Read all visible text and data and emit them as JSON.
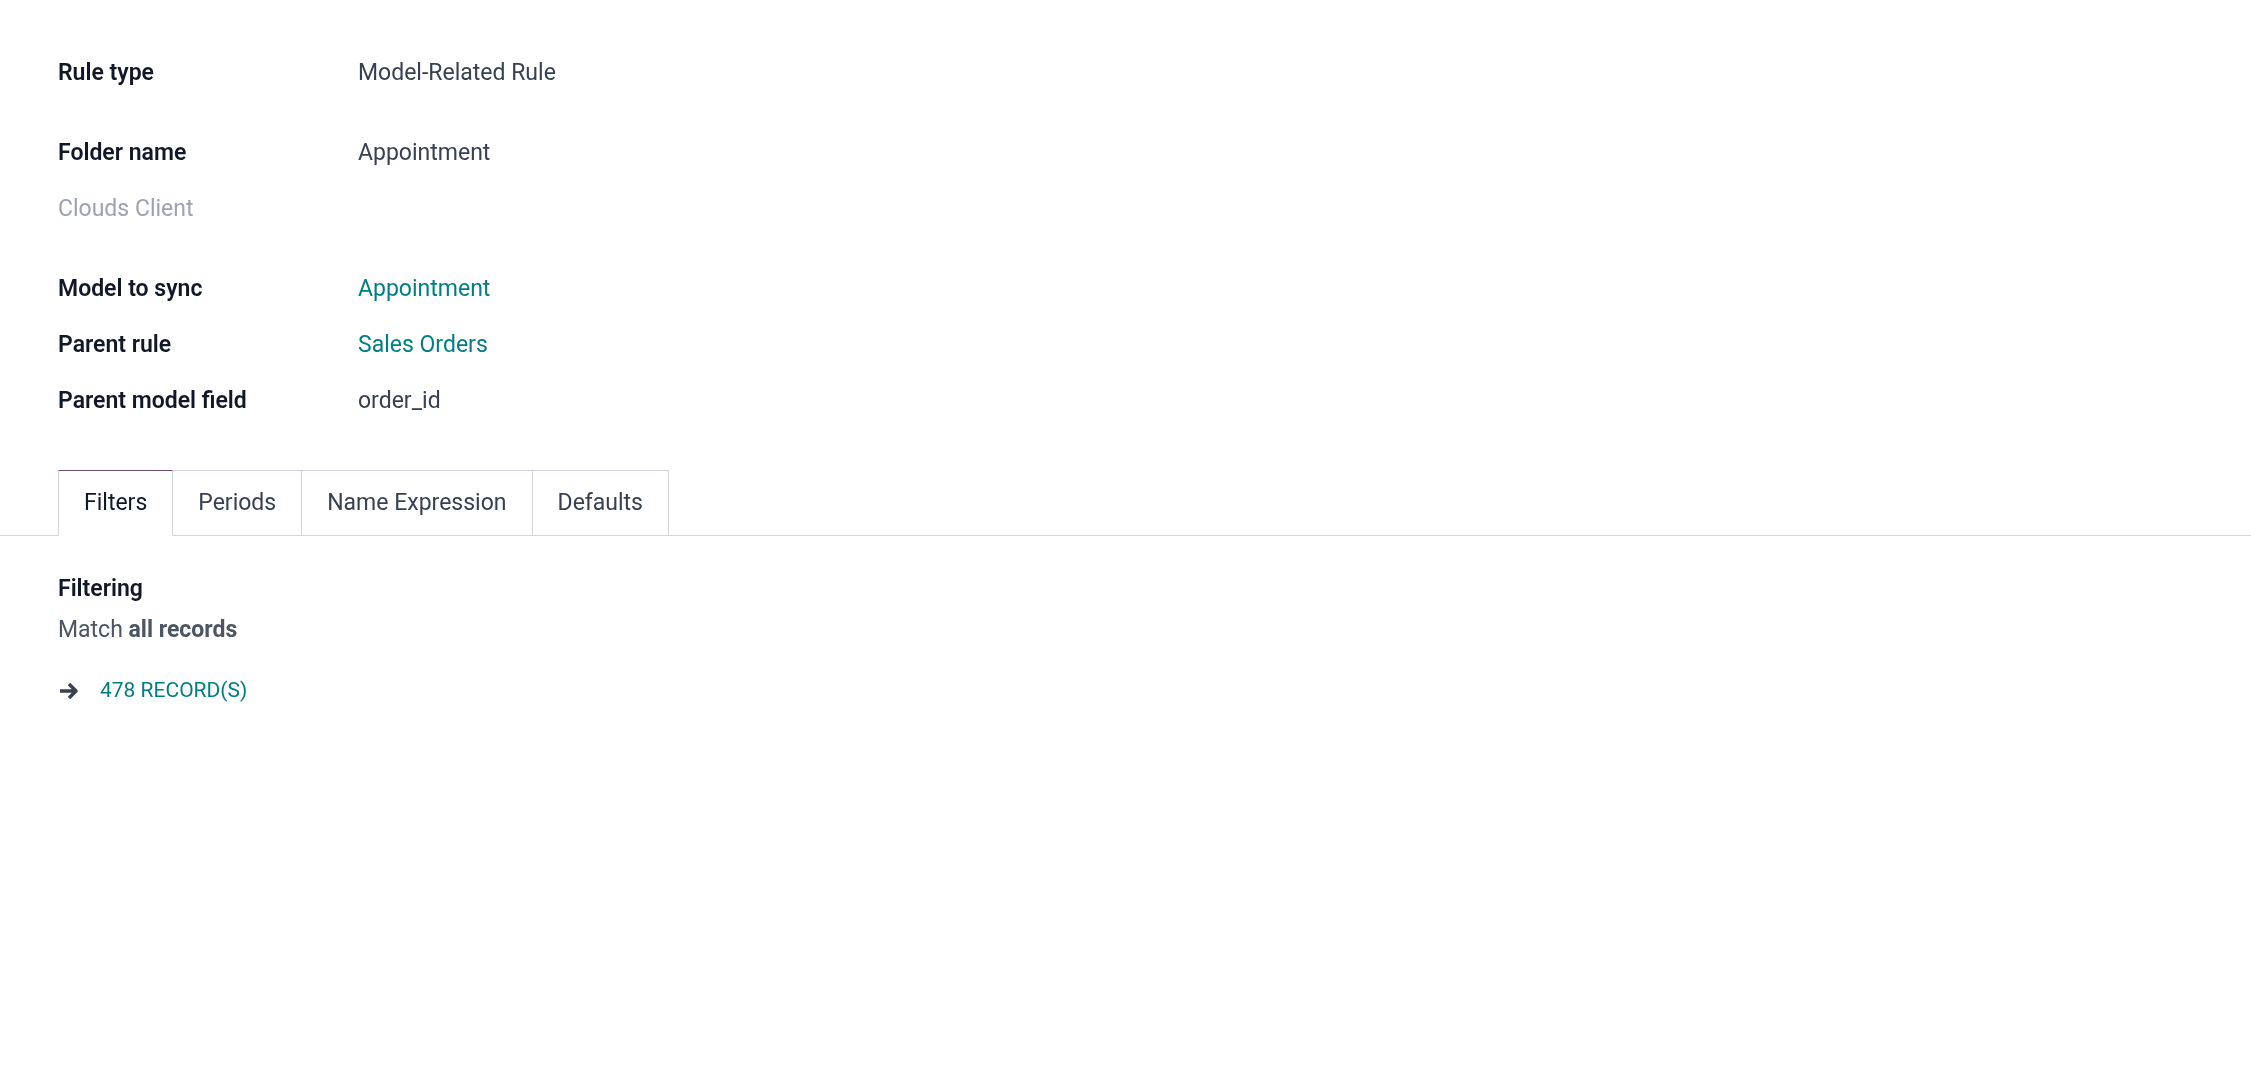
{
  "groups": [
    {
      "fields": [
        {
          "label": "Rule type",
          "value": "Model-Related Rule",
          "kind": "text"
        }
      ]
    },
    {
      "fields": [
        {
          "label": "Folder name",
          "value": "Appointment",
          "kind": "text"
        }
      ],
      "note": "Clouds Client"
    },
    {
      "fields": [
        {
          "label": "Model to sync",
          "value": "Appointment",
          "kind": "link"
        },
        {
          "label": "Parent rule",
          "value": "Sales Orders",
          "kind": "link"
        },
        {
          "label": "Parent model field",
          "value": "order_id",
          "kind": "text"
        }
      ]
    }
  ],
  "tabs": [
    {
      "label": "Filters",
      "selected": true
    },
    {
      "label": "Periods",
      "selected": false
    },
    {
      "label": "Name Expression",
      "selected": false
    },
    {
      "label": "Defaults",
      "selected": false
    }
  ],
  "filtering": {
    "title": "Filtering",
    "summary": "Match **all records**",
    "records_link": "478 RECORD(S)"
  }
}
